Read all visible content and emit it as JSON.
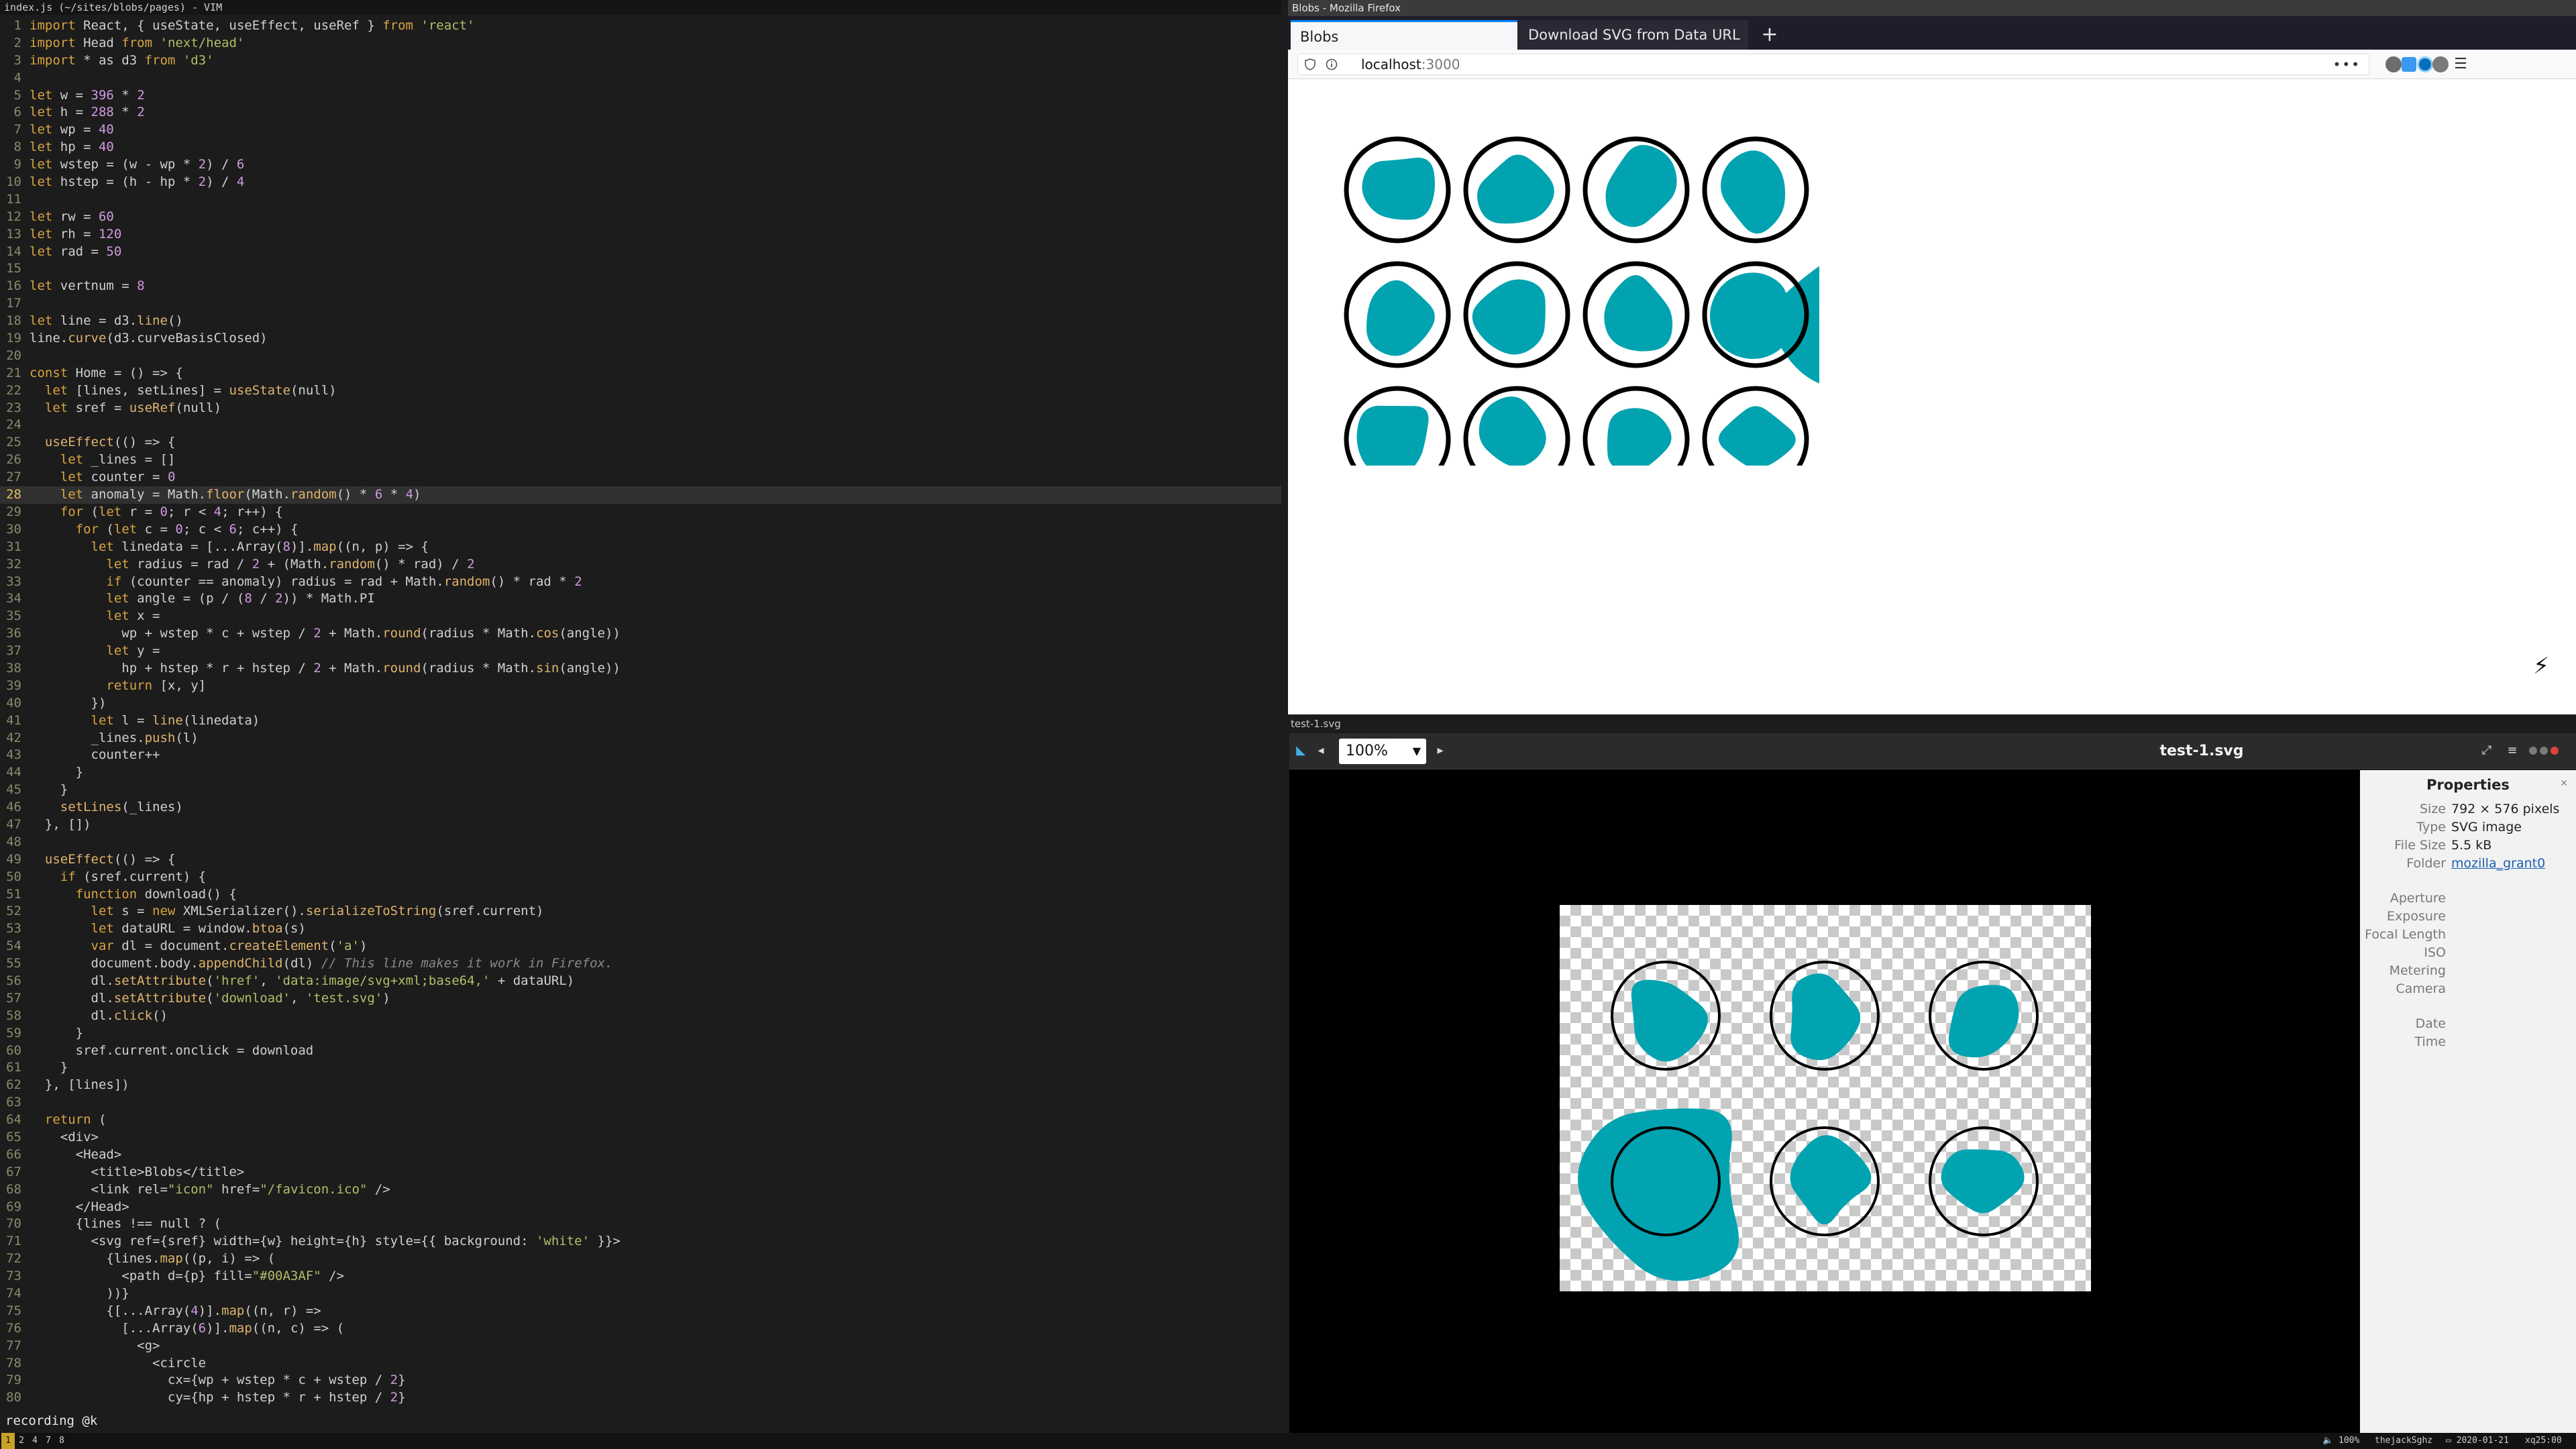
{
  "vim": {
    "title": "index.js (~/sites/blobs/pages) - VIM",
    "status": "recording @k",
    "cursor_line": 28,
    "lines": [
      "import React, { useState, useEffect, useRef } from 'react'",
      "import Head from 'next/head'",
      "import * as d3 from 'd3'",
      "",
      "let w = 396 * 2",
      "let h = 288 * 2",
      "let wp = 40",
      "let hp = 40",
      "let wstep = (w - wp * 2) / 6",
      "let hstep = (h - hp * 2) / 4",
      "",
      "let rw = 60",
      "let rh = 120",
      "let rad = 50",
      "",
      "let vertnum = 8",
      "",
      "let line = d3.line()",
      "line.curve(d3.curveBasisClosed)",
      "",
      "const Home = () => {",
      "  let [lines, setLines] = useState(null)",
      "  let sref = useRef(null)",
      "",
      "  useEffect(() => {",
      "    let _lines = []",
      "    let counter = 0",
      "    let anomaly = Math.floor(Math.random() * 6 * 4)",
      "    for (let r = 0; r < 4; r++) {",
      "      for (let c = 0; c < 6; c++) {",
      "        let linedata = [...Array(8)].map((n, p) => {",
      "          let radius = rad / 2 + (Math.random() * rad) / 2",
      "          if (counter == anomaly) radius = rad + Math.random() * rad * 2",
      "          let angle = (p / (8 / 2)) * Math.PI",
      "          let x =",
      "            wp + wstep * c + wstep / 2 + Math.round(radius * Math.cos(angle))",
      "          let y =",
      "            hp + hstep * r + hstep / 2 + Math.round(radius * Math.sin(angle))",
      "          return [x, y]",
      "        })",
      "        let l = line(linedata)",
      "        _lines.push(l)",
      "        counter++",
      "      }",
      "    }",
      "    setLines(_lines)",
      "  }, [])",
      "",
      "  useEffect(() => {",
      "    if (sref.current) {",
      "      function download() {",
      "        let s = new XMLSerializer().serializeToString(sref.current)",
      "        let dataURL = window.btoa(s)",
      "        var dl = document.createElement('a')",
      "        document.body.appendChild(dl) // This line makes it work in Firefox.",
      "        dl.setAttribute('href', 'data:image/svg+xml;base64,' + dataURL)",
      "        dl.setAttribute('download', 'test.svg')",
      "        dl.click()",
      "      }",
      "      sref.current.onclick = download",
      "    }",
      "  }, [lines])",
      "",
      "  return (",
      "    <div>",
      "      <Head>",
      "        <title>Blobs</title>",
      "        <link rel=\"icon\" href=\"/favicon.ico\" />",
      "      </Head>",
      "      {lines !== null ? (",
      "        <svg ref={sref} width={w} height={h} style={{ background: 'white' }}>",
      "          {lines.map((p, i) => (",
      "            <path d={p} fill=\"#00A3AF\" />",
      "          ))}",
      "          {[...Array(4)].map((n, r) =>",
      "            [...Array(6)].map((n, c) => (",
      "              <g>",
      "                <circle",
      "                  cx={wp + wstep * c + wstep / 2}",
      "                  cy={hp + hstep * r + hstep / 2}"
    ]
  },
  "taskbar": {
    "workspaces": [
      "1",
      "2",
      "4",
      "7",
      "8"
    ],
    "active_workspace": "1",
    "volume": "100%",
    "wifi": "thejackSghz",
    "date": "2020-01-21",
    "time": "xq25:00"
  },
  "firefox": {
    "window_title": "Blobs - Mozilla Firefox",
    "tabs": [
      {
        "label": "Blobs"
      },
      {
        "label": "Download SVG from Data URL"
      }
    ],
    "new_tab_label": "+",
    "url_host": "localhost",
    "url_port": ":3000",
    "page_menu_glyph": "•••",
    "menu_glyph": "☰",
    "bolt_glyph": "⚡",
    "blob_color": "#00A3AF",
    "blob_grid": {
      "rows": 4,
      "cols": 6,
      "anomaly": {
        "row": 1,
        "col": 4
      }
    }
  },
  "viewer": {
    "window_label": "test-1.svg",
    "title": "test-1.svg",
    "zoom": "100%",
    "blob_grid": {
      "rows": 2,
      "cols": 3,
      "anomaly": {
        "row": 1,
        "col": 0
      }
    },
    "properties": {
      "heading": "Properties",
      "rows": [
        {
          "label": "Size",
          "value": "792 × 576 pixels"
        },
        {
          "label": "Type",
          "value": "SVG image"
        },
        {
          "label": "File Size",
          "value": "5.5 kB"
        },
        {
          "label": "Folder",
          "value": "mozilla_grant0",
          "link": true
        },
        {
          "label": "Aperture",
          "value": ""
        },
        {
          "label": "Exposure",
          "value": ""
        },
        {
          "label": "Focal Length",
          "value": ""
        },
        {
          "label": "ISO",
          "value": ""
        },
        {
          "label": "Metering",
          "value": ""
        },
        {
          "label": "Camera",
          "value": ""
        },
        {
          "label": "Date",
          "value": ""
        },
        {
          "label": "Time",
          "value": ""
        }
      ]
    }
  }
}
